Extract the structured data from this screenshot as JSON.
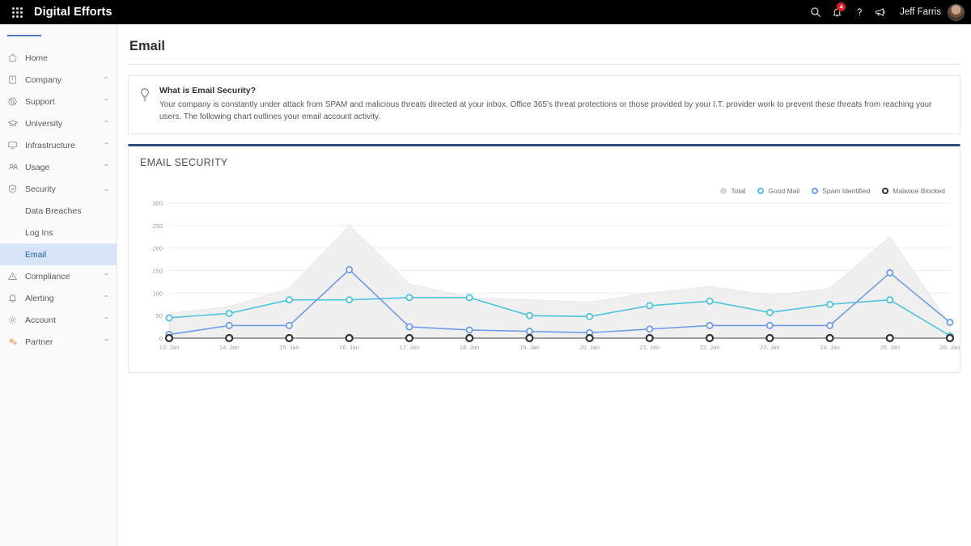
{
  "topbar": {
    "app_launcher_icon": "waffle-grid-icon",
    "brand": "Digital Efforts",
    "search_icon": "search-icon",
    "notifications_icon": "bell-icon",
    "notifications_badge": "4",
    "help_icon": "question-mark-icon",
    "announcements_icon": "megaphone-icon",
    "user_name": "Jeff Farris",
    "avatar": "user-avatar"
  },
  "sidebar": {
    "toggle_icon": "hamburger-icon",
    "items": [
      {
        "label": "Home",
        "icon": "home-icon",
        "expandable": false,
        "chevron": ""
      },
      {
        "label": "Company",
        "icon": "building-icon",
        "expandable": true,
        "chevron": "⌃"
      },
      {
        "label": "Support",
        "icon": "lifebuoy-icon",
        "expandable": true,
        "chevron": "⌃"
      },
      {
        "label": "University",
        "icon": "graduation-cap-icon",
        "expandable": true,
        "chevron": "⌃"
      },
      {
        "label": "Infrastructure",
        "icon": "monitor-icon",
        "expandable": true,
        "chevron": "⌃"
      },
      {
        "label": "Usage",
        "icon": "people-icon",
        "expandable": true,
        "chevron": "⌃"
      },
      {
        "label": "Security",
        "icon": "shield-check-icon",
        "expandable": true,
        "chevron": "⌄"
      }
    ],
    "security_children": [
      {
        "label": "Data Breaches",
        "active": false
      },
      {
        "label": "Log Ins",
        "active": false
      },
      {
        "label": "Email",
        "active": true
      }
    ],
    "items_after": [
      {
        "label": "Compliance",
        "icon": "warning-triangle-icon",
        "expandable": true,
        "chevron": "⌃"
      },
      {
        "label": "Alerting",
        "icon": "bell-icon",
        "expandable": true,
        "chevron": "⌃"
      },
      {
        "label": "Account",
        "icon": "gear-icon",
        "expandable": true,
        "chevron": "⌃"
      },
      {
        "label": "Partner",
        "icon": "partner-gears-icon",
        "expandable": true,
        "chevron": "⌃"
      }
    ],
    "active_bg": "#d7e3f8",
    "active_color": "#2b5fa8"
  },
  "main": {
    "page_title": "Email",
    "info": {
      "icon": "lightbulb-icon",
      "title": "What is Email Security?",
      "text": "Your company is constantly under attack from SPAM and malicious threats directed at your inbox. Office 365's threat protections or those provided by your I.T. provider work to prevent these threats from reaching your users. The following chart outlines your email account activity."
    },
    "card_accent": "#2c4a7c"
  },
  "chart_data": {
    "type": "line",
    "title": "EMAIL SECURITY",
    "xlabel": "",
    "ylabel": "",
    "ylim": [
      0,
      300
    ],
    "yticks": [
      0,
      50,
      100,
      150,
      200,
      250,
      300
    ],
    "ytick_labels": [
      "0",
      "50",
      "100",
      "150",
      "200",
      "250",
      "300"
    ],
    "grid": true,
    "legend_position": "top-right",
    "categories": [
      "13. Jan",
      "14. Jan",
      "15. Jan",
      "16. Jan",
      "17. Jan",
      "18. Jan",
      "19. Jan",
      "20. Jan",
      "21. Jan",
      "22. Jan",
      "23. Jan",
      "24. Jan",
      "25. Jan",
      "26. Jan"
    ],
    "series": [
      {
        "name": "Total",
        "color": "#d8d8d8",
        "fill": true,
        "marker": "dot",
        "values": [
          55,
          70,
          110,
          250,
          120,
          90,
          85,
          80,
          100,
          115,
          95,
          110,
          225,
          30
        ]
      },
      {
        "name": "Good Mail",
        "color": "#4ec3dd",
        "fill": false,
        "marker": "ring",
        "values": [
          45,
          55,
          85,
          85,
          90,
          90,
          50,
          48,
          72,
          82,
          57,
          75,
          85,
          5
        ]
      },
      {
        "name": "Spam Identified",
        "color": "#6f9ce8",
        "fill": false,
        "marker": "ring",
        "values": [
          8,
          28,
          28,
          152,
          25,
          18,
          15,
          12,
          20,
          28,
          28,
          28,
          145,
          35
        ]
      },
      {
        "name": "Malware Blocked",
        "color": "#2f3337",
        "fill": false,
        "marker": "ring-dark",
        "values": [
          0,
          0,
          0,
          0,
          0,
          0,
          0,
          0,
          0,
          0,
          0,
          0,
          0,
          0
        ]
      }
    ]
  }
}
